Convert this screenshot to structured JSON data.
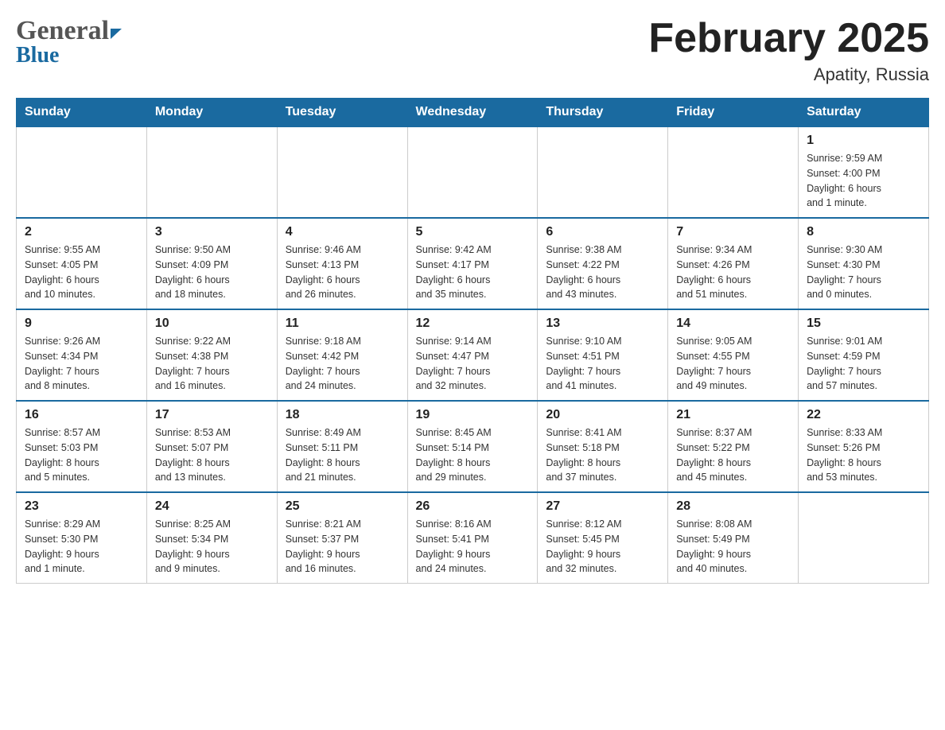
{
  "header": {
    "logo_line1": "General",
    "logo_line2": "Blue",
    "month_title": "February 2025",
    "location": "Apatity, Russia"
  },
  "days_of_week": [
    "Sunday",
    "Monday",
    "Tuesday",
    "Wednesday",
    "Thursday",
    "Friday",
    "Saturday"
  ],
  "weeks": [
    {
      "days": [
        {
          "num": "",
          "info": ""
        },
        {
          "num": "",
          "info": ""
        },
        {
          "num": "",
          "info": ""
        },
        {
          "num": "",
          "info": ""
        },
        {
          "num": "",
          "info": ""
        },
        {
          "num": "",
          "info": ""
        },
        {
          "num": "1",
          "info": "Sunrise: 9:59 AM\nSunset: 4:00 PM\nDaylight: 6 hours\nand 1 minute."
        }
      ]
    },
    {
      "days": [
        {
          "num": "2",
          "info": "Sunrise: 9:55 AM\nSunset: 4:05 PM\nDaylight: 6 hours\nand 10 minutes."
        },
        {
          "num": "3",
          "info": "Sunrise: 9:50 AM\nSunset: 4:09 PM\nDaylight: 6 hours\nand 18 minutes."
        },
        {
          "num": "4",
          "info": "Sunrise: 9:46 AM\nSunset: 4:13 PM\nDaylight: 6 hours\nand 26 minutes."
        },
        {
          "num": "5",
          "info": "Sunrise: 9:42 AM\nSunset: 4:17 PM\nDaylight: 6 hours\nand 35 minutes."
        },
        {
          "num": "6",
          "info": "Sunrise: 9:38 AM\nSunset: 4:22 PM\nDaylight: 6 hours\nand 43 minutes."
        },
        {
          "num": "7",
          "info": "Sunrise: 9:34 AM\nSunset: 4:26 PM\nDaylight: 6 hours\nand 51 minutes."
        },
        {
          "num": "8",
          "info": "Sunrise: 9:30 AM\nSunset: 4:30 PM\nDaylight: 7 hours\nand 0 minutes."
        }
      ]
    },
    {
      "days": [
        {
          "num": "9",
          "info": "Sunrise: 9:26 AM\nSunset: 4:34 PM\nDaylight: 7 hours\nand 8 minutes."
        },
        {
          "num": "10",
          "info": "Sunrise: 9:22 AM\nSunset: 4:38 PM\nDaylight: 7 hours\nand 16 minutes."
        },
        {
          "num": "11",
          "info": "Sunrise: 9:18 AM\nSunset: 4:42 PM\nDaylight: 7 hours\nand 24 minutes."
        },
        {
          "num": "12",
          "info": "Sunrise: 9:14 AM\nSunset: 4:47 PM\nDaylight: 7 hours\nand 32 minutes."
        },
        {
          "num": "13",
          "info": "Sunrise: 9:10 AM\nSunset: 4:51 PM\nDaylight: 7 hours\nand 41 minutes."
        },
        {
          "num": "14",
          "info": "Sunrise: 9:05 AM\nSunset: 4:55 PM\nDaylight: 7 hours\nand 49 minutes."
        },
        {
          "num": "15",
          "info": "Sunrise: 9:01 AM\nSunset: 4:59 PM\nDaylight: 7 hours\nand 57 minutes."
        }
      ]
    },
    {
      "days": [
        {
          "num": "16",
          "info": "Sunrise: 8:57 AM\nSunset: 5:03 PM\nDaylight: 8 hours\nand 5 minutes."
        },
        {
          "num": "17",
          "info": "Sunrise: 8:53 AM\nSunset: 5:07 PM\nDaylight: 8 hours\nand 13 minutes."
        },
        {
          "num": "18",
          "info": "Sunrise: 8:49 AM\nSunset: 5:11 PM\nDaylight: 8 hours\nand 21 minutes."
        },
        {
          "num": "19",
          "info": "Sunrise: 8:45 AM\nSunset: 5:14 PM\nDaylight: 8 hours\nand 29 minutes."
        },
        {
          "num": "20",
          "info": "Sunrise: 8:41 AM\nSunset: 5:18 PM\nDaylight: 8 hours\nand 37 minutes."
        },
        {
          "num": "21",
          "info": "Sunrise: 8:37 AM\nSunset: 5:22 PM\nDaylight: 8 hours\nand 45 minutes."
        },
        {
          "num": "22",
          "info": "Sunrise: 8:33 AM\nSunset: 5:26 PM\nDaylight: 8 hours\nand 53 minutes."
        }
      ]
    },
    {
      "days": [
        {
          "num": "23",
          "info": "Sunrise: 8:29 AM\nSunset: 5:30 PM\nDaylight: 9 hours\nand 1 minute."
        },
        {
          "num": "24",
          "info": "Sunrise: 8:25 AM\nSunset: 5:34 PM\nDaylight: 9 hours\nand 9 minutes."
        },
        {
          "num": "25",
          "info": "Sunrise: 8:21 AM\nSunset: 5:37 PM\nDaylight: 9 hours\nand 16 minutes."
        },
        {
          "num": "26",
          "info": "Sunrise: 8:16 AM\nSunset: 5:41 PM\nDaylight: 9 hours\nand 24 minutes."
        },
        {
          "num": "27",
          "info": "Sunrise: 8:12 AM\nSunset: 5:45 PM\nDaylight: 9 hours\nand 32 minutes."
        },
        {
          "num": "28",
          "info": "Sunrise: 8:08 AM\nSunset: 5:49 PM\nDaylight: 9 hours\nand 40 minutes."
        },
        {
          "num": "",
          "info": ""
        }
      ]
    }
  ]
}
